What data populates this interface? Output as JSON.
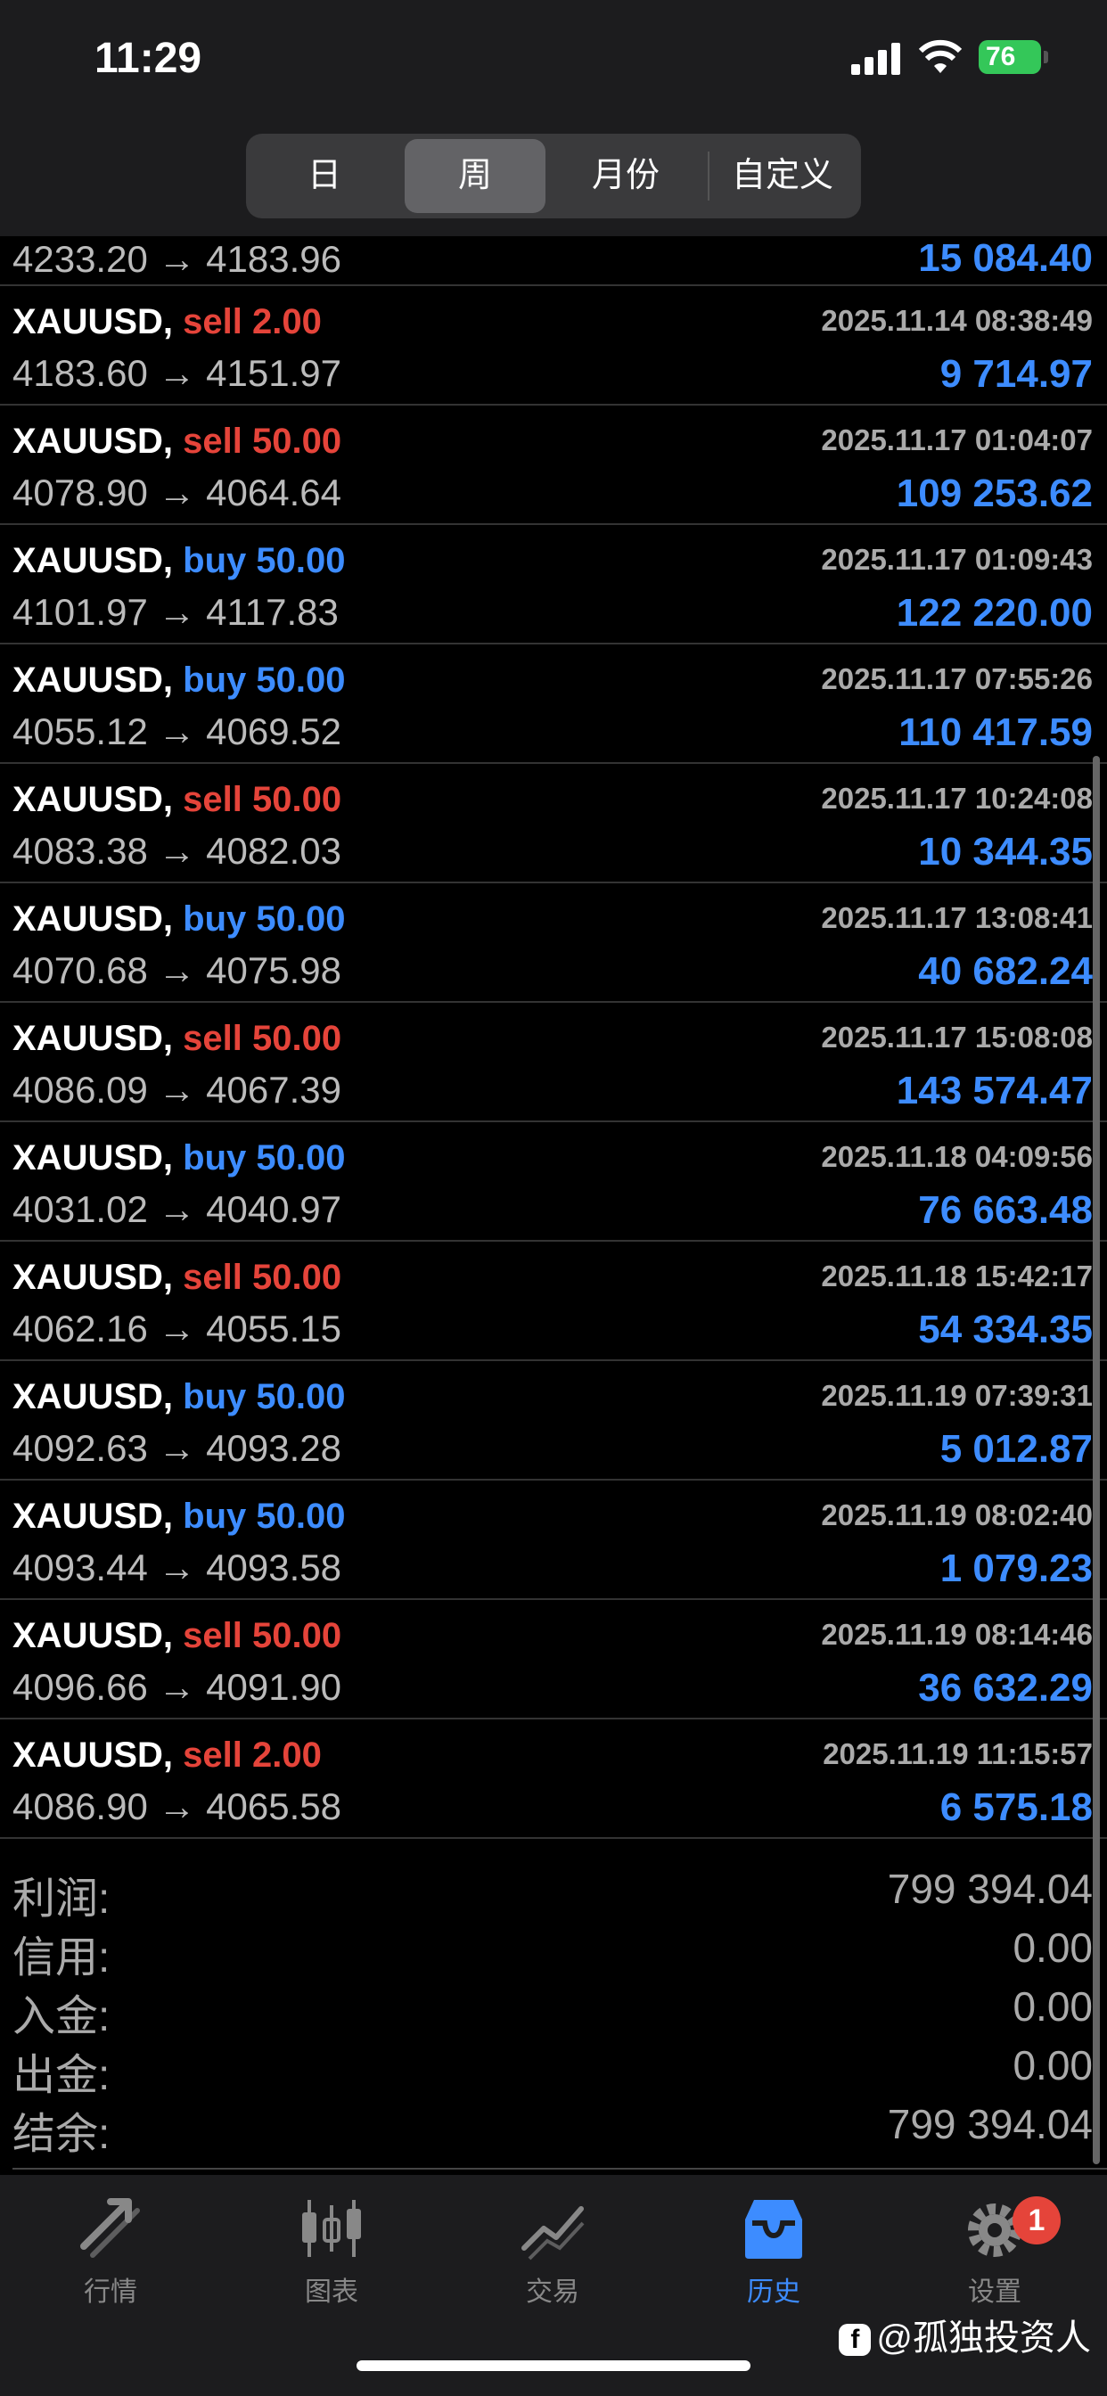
{
  "status": {
    "time": "11:29",
    "battery": "76",
    "signal_icon": "signal-icon",
    "wifi_icon": "wifi-icon"
  },
  "segments": [
    {
      "label": "日"
    },
    {
      "label": "周"
    },
    {
      "label": "月份"
    },
    {
      "label": "自定义"
    }
  ],
  "partial_row": {
    "price": "4233.20 → 4183.96",
    "profit": "15 084.40"
  },
  "trades": [
    {
      "symbol": "XAUUSD,",
      "side": "sell",
      "volume": "2.00",
      "time": "2025.11.14 08:38:49",
      "price": "4183.60 → 4151.97",
      "profit": "9 714.97"
    },
    {
      "symbol": "XAUUSD,",
      "side": "sell",
      "volume": "50.00",
      "time": "2025.11.17 01:04:07",
      "price": "4078.90 → 4064.64",
      "profit": "109 253.62"
    },
    {
      "symbol": "XAUUSD,",
      "side": "buy",
      "volume": "50.00",
      "time": "2025.11.17 01:09:43",
      "price": "4101.97 → 4117.83",
      "profit": "122 220.00"
    },
    {
      "symbol": "XAUUSD,",
      "side": "buy",
      "volume": "50.00",
      "time": "2025.11.17 07:55:26",
      "price": "4055.12 → 4069.52",
      "profit": "110 417.59"
    },
    {
      "symbol": "XAUUSD,",
      "side": "sell",
      "volume": "50.00",
      "time": "2025.11.17 10:24:08",
      "price": "4083.38 → 4082.03",
      "profit": "10 344.35"
    },
    {
      "symbol": "XAUUSD,",
      "side": "buy",
      "volume": "50.00",
      "time": "2025.11.17 13:08:41",
      "price": "4070.68 → 4075.98",
      "profit": "40 682.24"
    },
    {
      "symbol": "XAUUSD,",
      "side": "sell",
      "volume": "50.00",
      "time": "2025.11.17 15:08:08",
      "price": "4086.09 → 4067.39",
      "profit": "143 574.47"
    },
    {
      "symbol": "XAUUSD,",
      "side": "buy",
      "volume": "50.00",
      "time": "2025.11.18 04:09:56",
      "price": "4031.02 → 4040.97",
      "profit": "76 663.48"
    },
    {
      "symbol": "XAUUSD,",
      "side": "sell",
      "volume": "50.00",
      "time": "2025.11.18 15:42:17",
      "price": "4062.16 → 4055.15",
      "profit": "54 334.35"
    },
    {
      "symbol": "XAUUSD,",
      "side": "buy",
      "volume": "50.00",
      "time": "2025.11.19 07:39:31",
      "price": "4092.63 → 4093.28",
      "profit": "5 012.87"
    },
    {
      "symbol": "XAUUSD,",
      "side": "buy",
      "volume": "50.00",
      "time": "2025.11.19 08:02:40",
      "price": "4093.44 → 4093.58",
      "profit": "1 079.23"
    },
    {
      "symbol": "XAUUSD,",
      "side": "sell",
      "volume": "50.00",
      "time": "2025.11.19 08:14:46",
      "price": "4096.66 → 4091.90",
      "profit": "36 632.29"
    },
    {
      "symbol": "XAUUSD,",
      "side": "sell",
      "volume": "2.00",
      "time": "2025.11.19 11:15:57",
      "price": "4086.90 → 4065.58",
      "profit": "6 575.18"
    }
  ],
  "summary": [
    {
      "label": "利润:",
      "value": "799 394.04"
    },
    {
      "label": "信用:",
      "value": "0.00"
    },
    {
      "label": "入金:",
      "value": "0.00"
    },
    {
      "label": "出金:",
      "value": "0.00"
    },
    {
      "label": "结余:",
      "value": "799 394.04"
    }
  ],
  "tabs": [
    {
      "label": "行情",
      "icon": "quotes-icon"
    },
    {
      "label": "图表",
      "icon": "chart-icon"
    },
    {
      "label": "交易",
      "icon": "trade-icon"
    },
    {
      "label": "历史",
      "icon": "history-icon"
    },
    {
      "label": "设置",
      "icon": "gear-icon",
      "badge": "1"
    }
  ],
  "watermark": "@孤独投资人",
  "colors": {
    "sell": "#e5443a",
    "buy": "#3d8cff",
    "profit": "#3d8cff",
    "active_tab": "#3d8cff"
  }
}
